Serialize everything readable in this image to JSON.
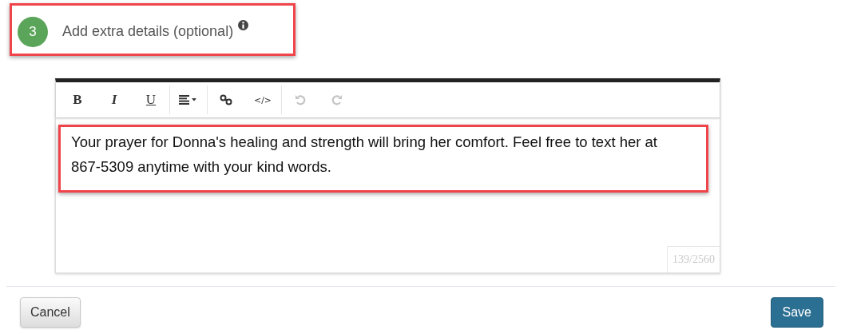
{
  "step": {
    "number": "3",
    "title": "Add extra details (optional)",
    "highlighted": true
  },
  "toolbar": [
    {
      "kind": "bold",
      "label": "B",
      "disabled": false
    },
    {
      "kind": "italic",
      "label": "I",
      "disabled": false
    },
    {
      "kind": "underline",
      "label": "U",
      "disabled": false
    },
    {
      "kind": "align",
      "disabled": false
    },
    {
      "kind": "link",
      "disabled": false
    },
    {
      "kind": "code",
      "label": "</>",
      "disabled": false
    },
    {
      "kind": "undo",
      "disabled": true
    },
    {
      "kind": "redo",
      "disabled": true
    }
  ],
  "editor": {
    "text": "Your prayer for Donna's healing and strength will bring her comfort. Feel free to text her at 867-5309 anytime with your kind words.",
    "highlighted": true,
    "counter": "139/2560"
  },
  "buttons": [
    {
      "kind": "secondary",
      "label": "Cancel"
    },
    {
      "kind": "primary",
      "label": "Save"
    }
  ]
}
